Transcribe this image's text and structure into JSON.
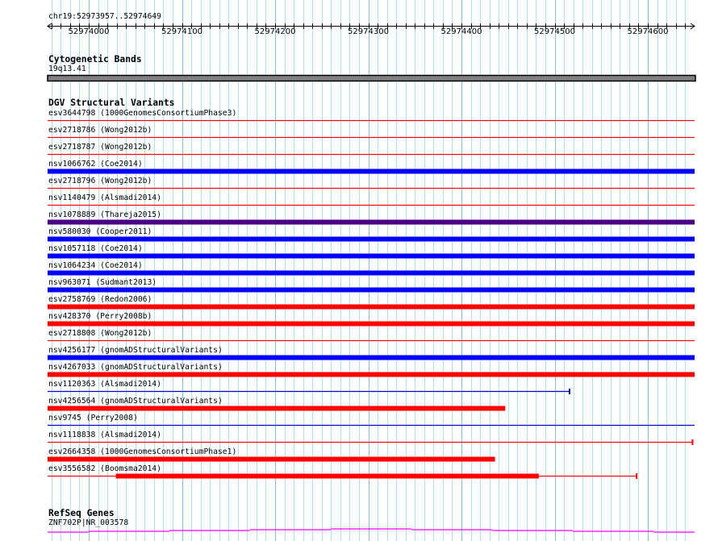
{
  "ruler": {
    "location": "chr19:52973957..52974649",
    "start": 52973957,
    "end": 52974649,
    "tick_labels": [
      "52974000",
      "52974100",
      "52974200",
      "52974300",
      "52974400",
      "52974500",
      "52974600"
    ]
  },
  "cytobands": {
    "title": "Cytogenetic Bands",
    "band": "19q13.41",
    "band_color": "#808080"
  },
  "dgv": {
    "title": "DGV Structural Variants",
    "colors": {
      "red": "#ff0000",
      "blue": "#0000ff",
      "darkblue": "#0000cc",
      "indigo": "#4b0082"
    },
    "rows": [
      {
        "label": "esv3644798 (1000GenomesConsortiumPhase3)",
        "style": "thin",
        "color": "red"
      },
      {
        "label": "esv2718786 (Wong2012b)",
        "style": "thin",
        "color": "red"
      },
      {
        "label": "esv2718787 (Wong2012b)",
        "style": "thin",
        "color": "red"
      },
      {
        "label": "nsv1066762 (Coe2014)",
        "style": "thick",
        "color": "blue"
      },
      {
        "label": "esv2718796 (Wong2012b)",
        "style": "thin",
        "color": "red"
      },
      {
        "label": "nsv1140479 (Alsmadi2014)",
        "style": "thin",
        "color": "red"
      },
      {
        "label": "nsv1078889 (Thareja2015)",
        "style": "thick",
        "color": "indigo"
      },
      {
        "label": "nsv580030 (Cooper2011)",
        "style": "thick",
        "color": "blue"
      },
      {
        "label": "nsv1057118 (Coe2014)",
        "style": "thick",
        "color": "blue"
      },
      {
        "label": "nsv1064234 (Coe2014)",
        "style": "thick",
        "color": "blue"
      },
      {
        "label": "nsv963071 (Sudmant2013)",
        "style": "thick",
        "color": "blue"
      },
      {
        "label": "esv2758769 (Redon2006)",
        "style": "thick",
        "color": "red"
      },
      {
        "label": "nsv428370 (Perry2008b)",
        "style": "thick",
        "color": "red"
      },
      {
        "label": "esv2718808 (Wong2012b)",
        "style": "thin",
        "color": "red"
      },
      {
        "label": "nsv4256177 (gnomADStructuralVariants)",
        "style": "thick",
        "color": "blue"
      },
      {
        "label": "nsv4267033 (gnomADStructuralVariants)",
        "style": "thick",
        "color": "red"
      },
      {
        "label": "nsv1120363 (Alsmadi2014)",
        "style": "thin",
        "color": "darkblue",
        "end": 52974516,
        "cap": true
      },
      {
        "label": "nsv4256564 (gnomADStructuralVariants)",
        "style": "thick",
        "color": "red",
        "end": 52974447
      },
      {
        "label": "nsv9745 (Perry2008)",
        "style": "thin",
        "color": "darkblue"
      },
      {
        "label": "nsv1118838 (Alsmadi2014)",
        "style": "thin",
        "color": "red",
        "end": 52974648,
        "cap": true
      },
      {
        "label": "esv2664358 (1000GenomesConsortiumPhase1)",
        "style": "thick",
        "color": "red",
        "end": 52974436
      },
      {
        "label": "esv3556582 (Boomsma2014)",
        "style": "mixed",
        "color": "red",
        "thick_start": 52974029,
        "thick_end": 52974483,
        "end": 52974588,
        "cap": true
      }
    ]
  },
  "refseq": {
    "title": "RefSeq Genes",
    "gene": "ZNF702P|NR_003578",
    "color": "#ff00ff"
  }
}
